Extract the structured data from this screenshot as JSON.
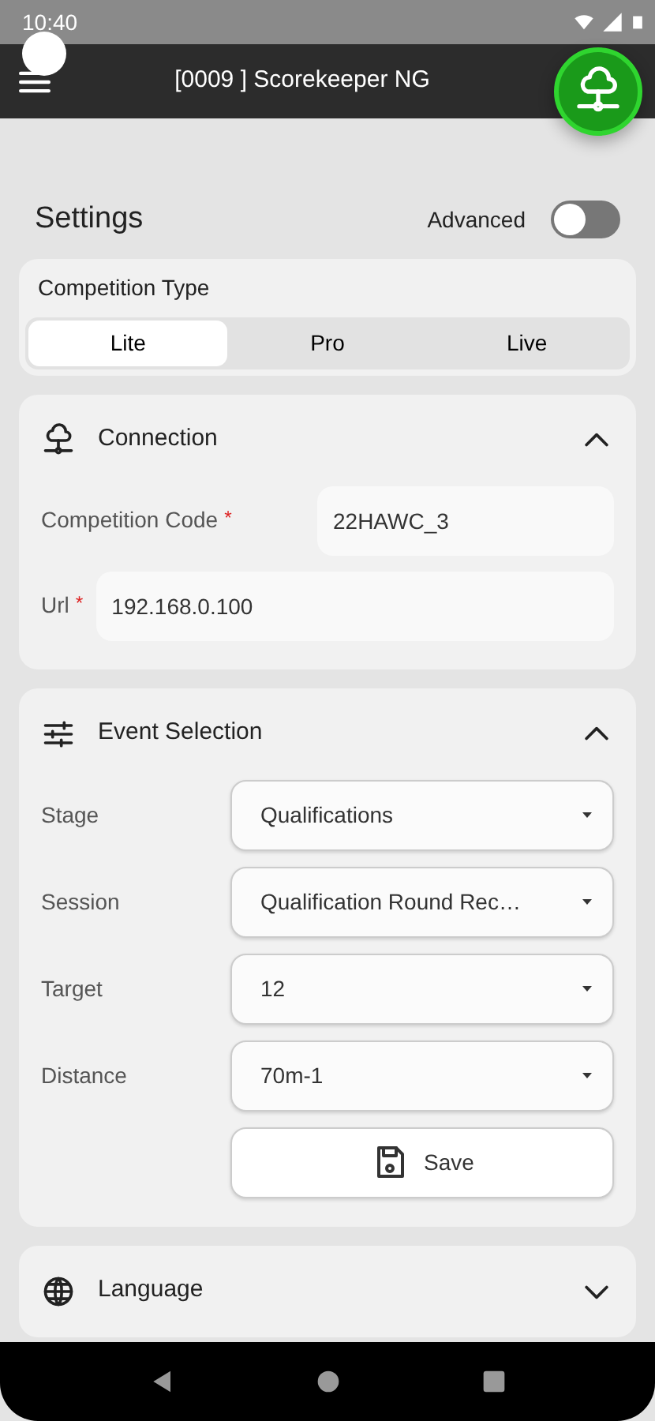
{
  "status_bar": {
    "time": "10:40"
  },
  "app_bar": {
    "title": "[0009 ] Scorekeeper NG"
  },
  "page_title": "Settings",
  "advanced": {
    "label": "Advanced",
    "on": false
  },
  "competition_type": {
    "label": "Competition Type",
    "options": [
      {
        "label": "Lite",
        "selected": true
      },
      {
        "label": "Pro",
        "selected": false
      },
      {
        "label": "Live",
        "selected": false
      }
    ]
  },
  "sections": [
    {
      "kind": "connection",
      "title": "Connection",
      "expanded": true,
      "fields": [
        {
          "kind": "text",
          "label": "Competition Code",
          "required_mark": "*",
          "value": "22HAWC_3"
        },
        {
          "kind": "text",
          "label": "Url",
          "required_mark": "*",
          "value": "192.168.0.100"
        }
      ]
    },
    {
      "kind": "event",
      "title": "Event Selection",
      "expanded": true,
      "fields": [
        {
          "kind": "select",
          "label": "Stage",
          "value": "Qualifications"
        },
        {
          "kind": "select",
          "label": "Session",
          "value": "Qualification Round Rec…"
        },
        {
          "kind": "select",
          "label": "Target",
          "value": "12"
        },
        {
          "kind": "select",
          "label": "Distance",
          "value": "70m-1"
        }
      ],
      "button": "Save"
    },
    {
      "kind": "language",
      "title": "Language",
      "expanded": false
    }
  ]
}
